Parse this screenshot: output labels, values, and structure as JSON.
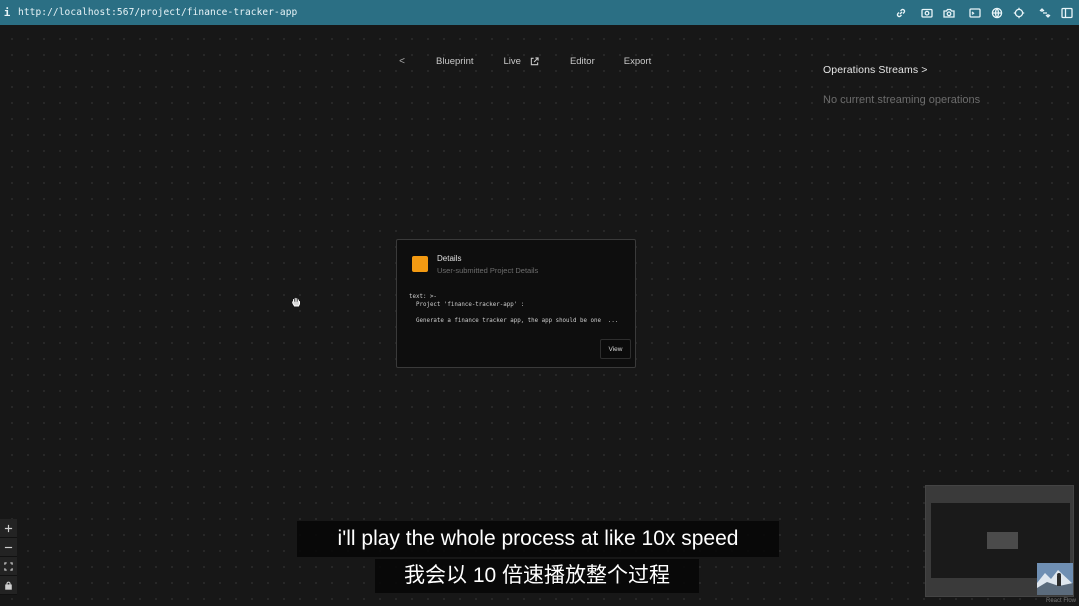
{
  "browser": {
    "info_glyph": "i",
    "url": "http://localhost:567/project/finance-tracker-app",
    "toolbar_icons": [
      "link-icon",
      "capture-icon",
      "camera-icon",
      "terminal-icon",
      "globe-icon",
      "target-icon",
      "resize-icon",
      "sidebar-icon"
    ]
  },
  "nav": {
    "back_glyph": "<",
    "blueprint": "Blueprint",
    "live": "Live",
    "editor": "Editor",
    "export": "Export"
  },
  "operations": {
    "title": "Operations Streams >",
    "empty_text": "No current streaming operations"
  },
  "node": {
    "title": "Details",
    "subtitle": "User-submitted Project Details",
    "code": "text: >-\n  Project 'finance-tracker-app' :\n\n  Generate a finance tracker app, the app should be one  ...",
    "view_label": "View",
    "swatch_color": "#f39a12"
  },
  "controls": [
    "zoom-in",
    "zoom-out",
    "fit-view",
    "lock"
  ],
  "attribution": "React Flow",
  "subtitles": {
    "english": "i'll play the whole process at like 10x speed",
    "chinese": "我会以 10 倍速播放整个过程"
  }
}
